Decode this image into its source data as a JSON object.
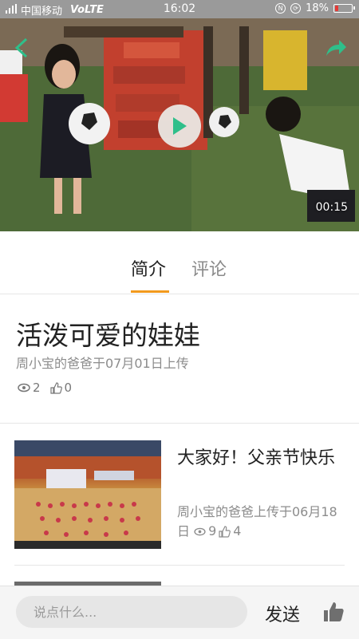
{
  "status_bar": {
    "carrier": "中国移动",
    "network": "VoLTE",
    "time": "16:02",
    "battery": "18%",
    "battery_level": 0.18,
    "battery_color": "#e53935"
  },
  "video": {
    "duration": "00:15",
    "back_icon": "chevron-left-icon",
    "share_icon": "share-icon",
    "play_icon": "play-icon",
    "accent": "#2fbf8a"
  },
  "tabs": [
    {
      "label": "简介",
      "active": true
    },
    {
      "label": "评论",
      "active": false
    }
  ],
  "tab_accent": "#f29a1d",
  "detail": {
    "title": "活泼可爱的娃娃",
    "uploader": "周小宝的爸爸于07月01日上传",
    "views": "2",
    "likes": "0"
  },
  "related": [
    {
      "title": "大家好！父亲节快乐",
      "meta": "周小宝的爸爸上传于06月18日",
      "views": "9",
      "likes": "4"
    }
  ],
  "comment_bar": {
    "placeholder": "说点什么...",
    "send_label": "发送",
    "like_icon": "thumbs-up-icon"
  }
}
